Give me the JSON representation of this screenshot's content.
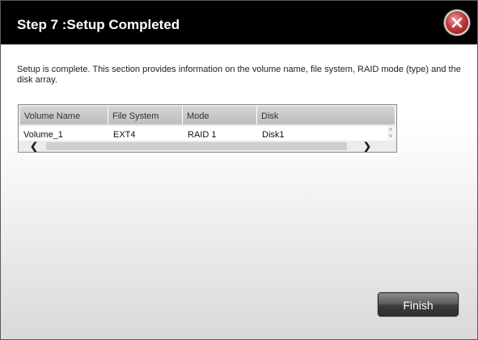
{
  "dialog": {
    "title": "Step 7 :Setup Completed",
    "close_icon": "close-icon",
    "description": "Setup is complete. This section provides information on the volume name, file system, RAID mode (type) and the disk array."
  },
  "grid": {
    "columns": [
      "Volume Name",
      "File System",
      "Mode",
      "Disk"
    ],
    "rows": [
      [
        "Volume_1",
        "EXT4",
        "RAID 1",
        "Disk1"
      ]
    ]
  },
  "scroll": {
    "left_icon": "chevron-left-icon",
    "right_icon": "chevron-right-icon",
    "up_icon": "arrow-up-icon",
    "down_icon": "arrow-down-icon",
    "left_glyph": "❮",
    "right_glyph": "❯",
    "up_glyph": "˄",
    "down_glyph": "˅"
  },
  "footer": {
    "finish_label": "Finish"
  }
}
